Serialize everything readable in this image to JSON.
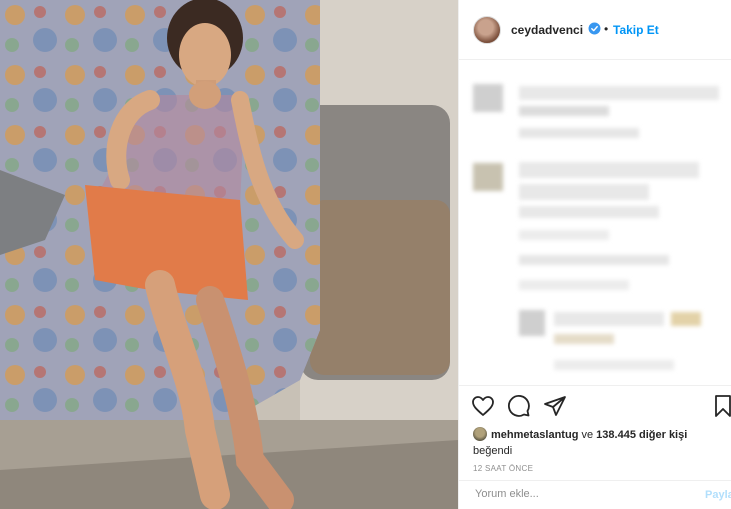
{
  "header": {
    "username": "ceydadvenci",
    "separator": "•",
    "follow_label": "Takip Et"
  },
  "likes": {
    "liker": "mehmetaslantug",
    "connector": "ve",
    "count_text": "138.445 diğer kişi",
    "suffix": "beğendi"
  },
  "timestamp": "12 saat önce",
  "comment_input": {
    "placeholder": "Yorum ekle...",
    "share_label": "Paylaş"
  },
  "colors": {
    "follow_blue": "#0095f6",
    "verified_blue": "#3897f0",
    "text": "#262626",
    "muted": "#8e8e8e"
  },
  "icons": [
    "heart-icon",
    "comment-icon",
    "share-icon",
    "bookmark-icon",
    "verified-badge-icon"
  ]
}
